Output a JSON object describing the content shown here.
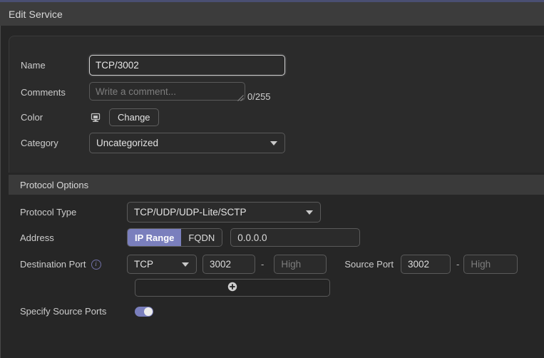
{
  "window": {
    "title": "Edit Service",
    "accent_color": "#4a4f72",
    "titlebar_color": "#3c3c3c"
  },
  "general": {
    "name": {
      "label": "Name",
      "value": "TCP/3002"
    },
    "comments": {
      "label": "Comments",
      "value": "",
      "placeholder": "Write a comment...",
      "char_count": "0/255"
    },
    "color": {
      "label": "Color",
      "swatch_icon": "color-swatch-icon",
      "change_label": "Change"
    },
    "category": {
      "label": "Category",
      "value": "Uncategorized"
    }
  },
  "protocol_options": {
    "section_title": "Protocol Options",
    "protocol_type": {
      "label": "Protocol Type",
      "value": "TCP/UDP/UDP-Lite/SCTP"
    },
    "address": {
      "label": "Address",
      "modes": [
        "IP Range",
        "FQDN"
      ],
      "selected_mode": "IP Range",
      "value": "0.0.0.0",
      "active_color": "#7a7fbd"
    },
    "destination_port": {
      "label": "Destination Port",
      "info_icon": "info-icon",
      "protocol": "TCP",
      "low_value": "3002",
      "high_value": "",
      "high_placeholder": "High",
      "range_separator": "-"
    },
    "source_port": {
      "label": "Source Port",
      "low_value": "3002",
      "high_value": "",
      "high_placeholder": "High",
      "range_separator": "-"
    },
    "add_row": {
      "icon": "plus-circle-icon"
    },
    "specify_source_ports": {
      "label": "Specify Source Ports",
      "enabled": true
    }
  }
}
